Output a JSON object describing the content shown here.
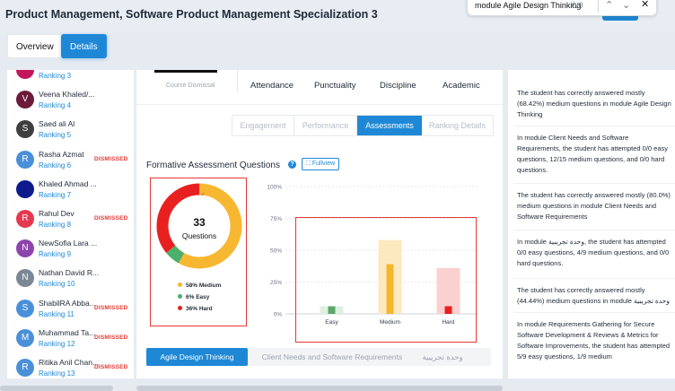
{
  "app": {
    "title": "Product Management, Software Product Management Specialization 3"
  },
  "find_bar": {
    "query": "module Agile Design Thinking",
    "count": "0/0"
  },
  "tabs": {
    "overview": "Overview",
    "details": "Details"
  },
  "students": [
    {
      "initial": "",
      "name": "",
      "ranking": "Ranking 3",
      "dismissed": "",
      "color": "#c2185b"
    },
    {
      "initial": "V",
      "name": "Veena Khaled/...",
      "ranking": "Ranking 4",
      "dismissed": "",
      "color": "#6d1b3a"
    },
    {
      "initial": "S",
      "name": "Saed ali Al",
      "ranking": "Ranking 5",
      "dismissed": "",
      "color": "#3f3f3f"
    },
    {
      "initial": "R",
      "name": "Rasha Azmat",
      "ranking": "Ranking 6",
      "dismissed": "DISMISSED",
      "color": "#4a90d9"
    },
    {
      "initial": "",
      "name": "Khaled Ahmad ...",
      "ranking": "Ranking 7",
      "dismissed": "",
      "color": "#0d1b8c"
    },
    {
      "initial": "R",
      "name": "Rahul Dev",
      "ranking": "Ranking 8",
      "dismissed": "DISMISSED",
      "color": "#e53950"
    },
    {
      "initial": "N",
      "name": "NewSofia Lara ...",
      "ranking": "Ranking 9",
      "dismissed": "",
      "color": "#8e44ad"
    },
    {
      "initial": "N",
      "name": "Nathan David R...",
      "ranking": "Ranking 10",
      "dismissed": "",
      "color": "#7b8794"
    },
    {
      "initial": "S",
      "name": "ShabilRA Abba...",
      "ranking": "Ranking 11",
      "dismissed": "DISMISSED",
      "color": "#4a90d9"
    },
    {
      "initial": "M",
      "name": "Muhammad Ta...",
      "ranking": "Ranking 12",
      "dismissed": "DISMISSED",
      "color": "#4a90d9"
    },
    {
      "initial": "R",
      "name": "Ritika Anil Chan...",
      "ranking": "Ranking 13",
      "dismissed": "DISMISSED",
      "color": "#4a90d9"
    }
  ],
  "header_metrics": {
    "course_dismissal": "Course Dismissal",
    "items": [
      "Attendance",
      "Punctuality",
      "Discipline",
      "Academic"
    ]
  },
  "sub_tabs": [
    "Engagement",
    "Performance",
    "Assessments",
    "Ranking Details"
  ],
  "section": {
    "title": "Formative Assessment Questions",
    "help": "?",
    "fullview": "Fullview"
  },
  "donut": {
    "total": "33",
    "label": "Questions",
    "segments": [
      {
        "name": "58% Medium",
        "percent": 58,
        "color": "#f7b731"
      },
      {
        "name": "6% Easy",
        "percent": 6,
        "color": "#4caf6a"
      },
      {
        "name": "36% Hard",
        "percent": 36,
        "color": "#e8201f"
      }
    ]
  },
  "chart_data": {
    "type": "bar",
    "categories": [
      "Easy",
      "Medium",
      "Hard"
    ],
    "y_ticks": [
      "100%",
      "75%",
      "50%",
      "25%",
      "0%"
    ],
    "ylim": [
      0,
      100
    ],
    "series": [
      {
        "values": [
          6,
          58,
          36
        ],
        "colors": [
          "#dff0e2",
          "#fde9c0",
          "#fbd0d0"
        ]
      },
      {
        "values": [
          6,
          39,
          6
        ],
        "colors": [
          "#5ca86c",
          "#f4b62a",
          "#e8201f"
        ]
      }
    ]
  },
  "module_tabs": [
    "Agile Design Thinking",
    "Client Needs and Software Requirements",
    "وحدة تجريبية"
  ],
  "insights": [
    "The student has correctly answered mostly (68.42%) medium questions in module Agile Design Thinking",
    "In module Client Needs and Software Requirements, the student has attempted 0/0 easy questions, 12/15 medium questions, and 0/0 hard questions.",
    "The student has correctly answered mostly (80.0%) medium questions in module Client Needs and Software Requirements",
    "In module وحدة تجريبية, the student has attempted 0/0 easy questions, 4/9 medium questions, and 0/0 hard questions.",
    "The student has correctly answered mostly (44.44%) medium questions in module وحدة تجريبية",
    "In module Requirements Gathering for Secure Software Development & Reviews & Metrics for Software Improvements, the student has attempted 5/9 easy questions, 1/9 medium"
  ]
}
